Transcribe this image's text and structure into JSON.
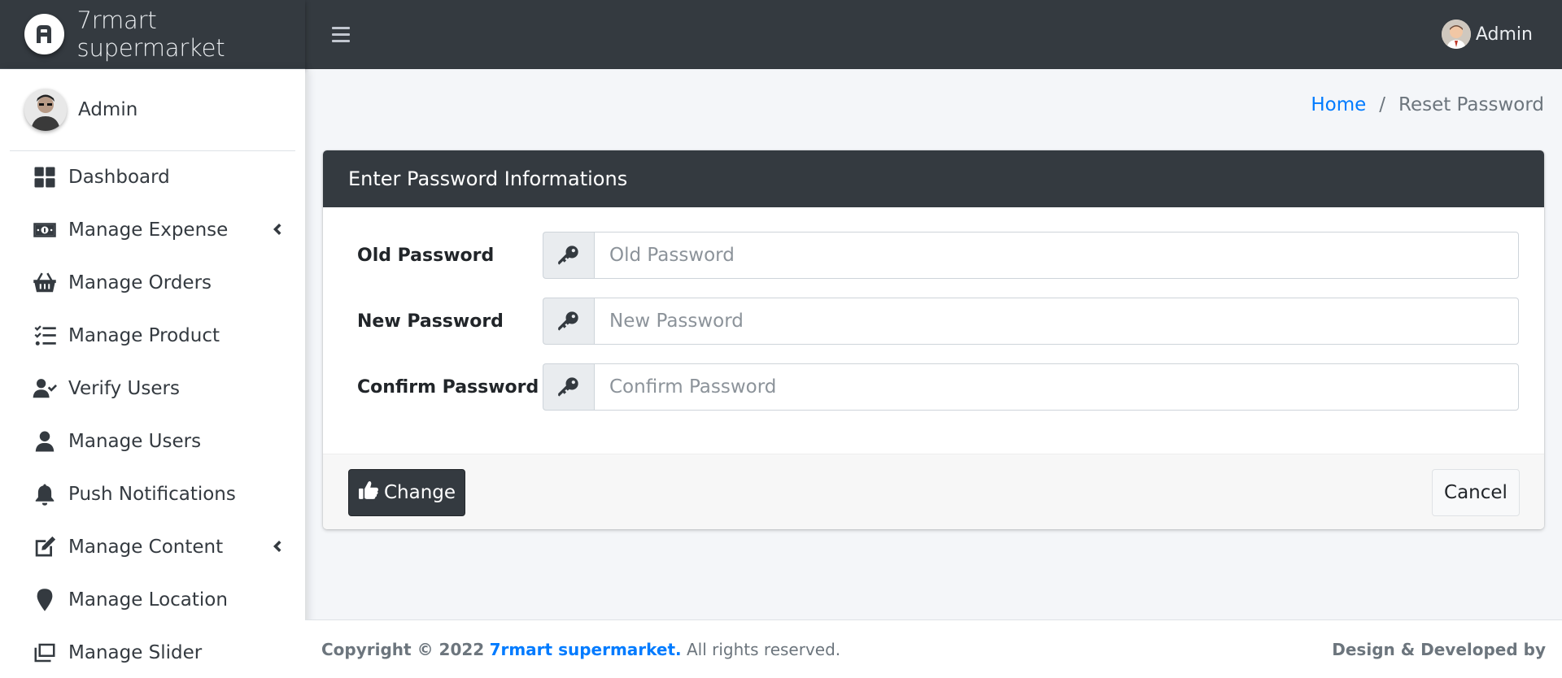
{
  "brand": {
    "name": "7rmart supermarket",
    "logo_icon": "brand-logo-icon"
  },
  "topbar": {
    "menu_icon": "hamburger-icon",
    "user_name": "Admin"
  },
  "sidebar": {
    "user_name": "Admin",
    "items": [
      {
        "label": "Dashboard",
        "icon": "dashboard-icon",
        "has_submenu": false
      },
      {
        "label": "Manage Expense",
        "icon": "money-bill-icon",
        "has_submenu": true
      },
      {
        "label": "Manage Orders",
        "icon": "basket-icon",
        "has_submenu": false
      },
      {
        "label": "Manage Product",
        "icon": "tasks-icon",
        "has_submenu": false
      },
      {
        "label": "Verify Users",
        "icon": "user-check-icon",
        "has_submenu": false
      },
      {
        "label": "Manage Users",
        "icon": "user-icon",
        "has_submenu": false
      },
      {
        "label": "Push Notifications",
        "icon": "bell-icon",
        "has_submenu": false
      },
      {
        "label": "Manage Content",
        "icon": "edit-icon",
        "has_submenu": true
      },
      {
        "label": "Manage Location",
        "icon": "map-marker-icon",
        "has_submenu": false
      },
      {
        "label": "Manage Slider",
        "icon": "slider-icon",
        "has_submenu": false
      }
    ]
  },
  "breadcrumb": {
    "home": "Home",
    "separator": "/",
    "current": "Reset Password"
  },
  "card": {
    "title": "Enter Password Informations",
    "fields": [
      {
        "label": "Old Password",
        "placeholder": "Old Password",
        "value": "",
        "icon": "key-icon"
      },
      {
        "label": "New Password",
        "placeholder": "New Password",
        "value": "",
        "icon": "key-icon"
      },
      {
        "label": "Confirm Password",
        "placeholder": "Confirm Password",
        "value": "",
        "icon": "key-icon"
      }
    ],
    "change_button": "Change",
    "change_icon": "thumbs-up-icon",
    "cancel_button": "Cancel"
  },
  "footer": {
    "copyright": "Copyright © 2022",
    "brand_link": "7rmart supermarket.",
    "rights": "All rights reserved.",
    "credit": "Design & Developed by"
  },
  "colors": {
    "dark": "#343a40",
    "link": "#007bff",
    "muted": "#6c757d",
    "background": "#f4f6f9"
  }
}
